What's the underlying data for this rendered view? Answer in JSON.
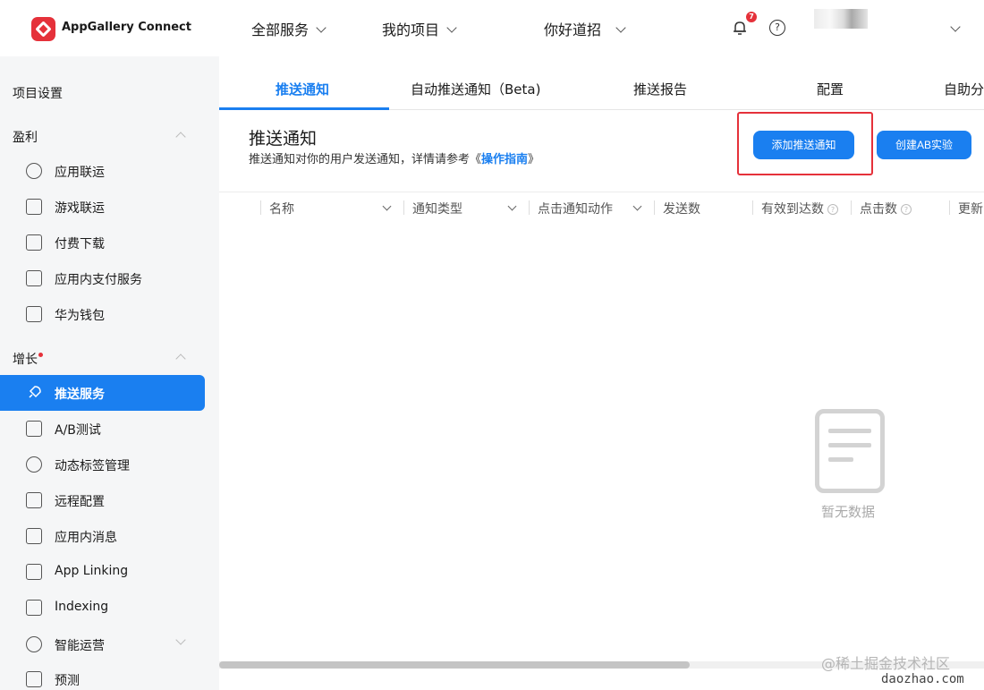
{
  "header": {
    "logo_text": "AppGallery Connect",
    "nav": [
      "全部服务",
      "我的项目",
      "你好道招"
    ],
    "notification_count": "7",
    "help_glyph": "?"
  },
  "sidebar": {
    "project_settings": "项目设置",
    "monetize": {
      "title": "盈利",
      "items": [
        "应用联运",
        "游戏联运",
        "付费下载",
        "应用内支付服务",
        "华为钱包"
      ]
    },
    "growth": {
      "title": "增长",
      "items": [
        "推送服务",
        "A/B测试",
        "动态标签管理",
        "远程配置",
        "应用内消息",
        "App Linking",
        "Indexing",
        "智能运营",
        "预测"
      ]
    }
  },
  "tabs": [
    "推送通知",
    "自动推送通知（Beta)",
    "推送报告",
    "配置",
    "自助分"
  ],
  "main": {
    "title": "推送通知",
    "desc_prefix": "推送通知对你的用户发送通知，详情请参考《",
    "desc_link": "操作指南",
    "desc_suffix": "》",
    "add_button": "添加推送通知",
    "ab_button": "创建AB实验"
  },
  "table": {
    "columns": [
      "名称",
      "通知类型",
      "点击通知动作",
      "发送数",
      "有效到达数",
      "点击数",
      "更新"
    ],
    "empty_text": "暂无数据"
  },
  "watermark": {
    "line1": "@稀土掘金技术社区",
    "line2": "daozhao.com"
  },
  "colors": {
    "accent": "#1a7ff0",
    "badge": "#e5313a",
    "highlight_box": "#e5313a"
  }
}
